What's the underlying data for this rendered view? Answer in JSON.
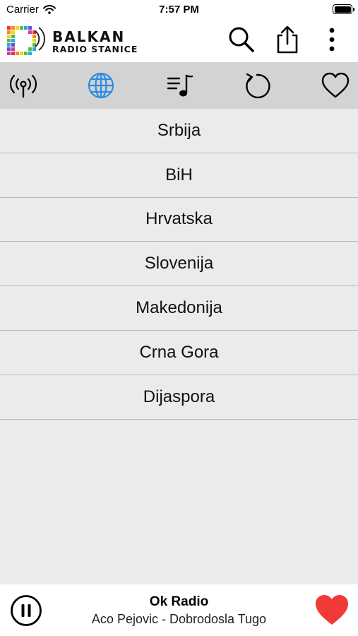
{
  "status_bar": {
    "carrier": "Carrier",
    "time": "7:57 PM",
    "battery_level": 1.0
  },
  "header": {
    "logo_title": "BALKAN",
    "logo_subtitle": "RADIO STANICE",
    "icons": [
      "search-icon",
      "share-icon",
      "more-vertical-icon"
    ]
  },
  "tabs": [
    {
      "icon": "broadcast-icon",
      "active": false
    },
    {
      "icon": "globe-icon",
      "active": true
    },
    {
      "icon": "music-list-icon",
      "active": false
    },
    {
      "icon": "history-icon",
      "active": false
    },
    {
      "icon": "heart-outline-icon",
      "active": false
    }
  ],
  "countries": [
    "Srbija",
    "BiH",
    "Hrvatska",
    "Slovenija",
    "Makedonija",
    "Crna Gora",
    "Dijaspora"
  ],
  "player": {
    "station": "Ok Radio",
    "track": "Aco Pejovic - Dobrodosla Tugo",
    "state": "playing"
  },
  "colors": {
    "accent": "#2a8de0",
    "favorite": "#f03a35",
    "tab_bar_bg": "#d3d3d3",
    "list_bg": "#ebebeb",
    "divider": "#b9b9b9"
  }
}
